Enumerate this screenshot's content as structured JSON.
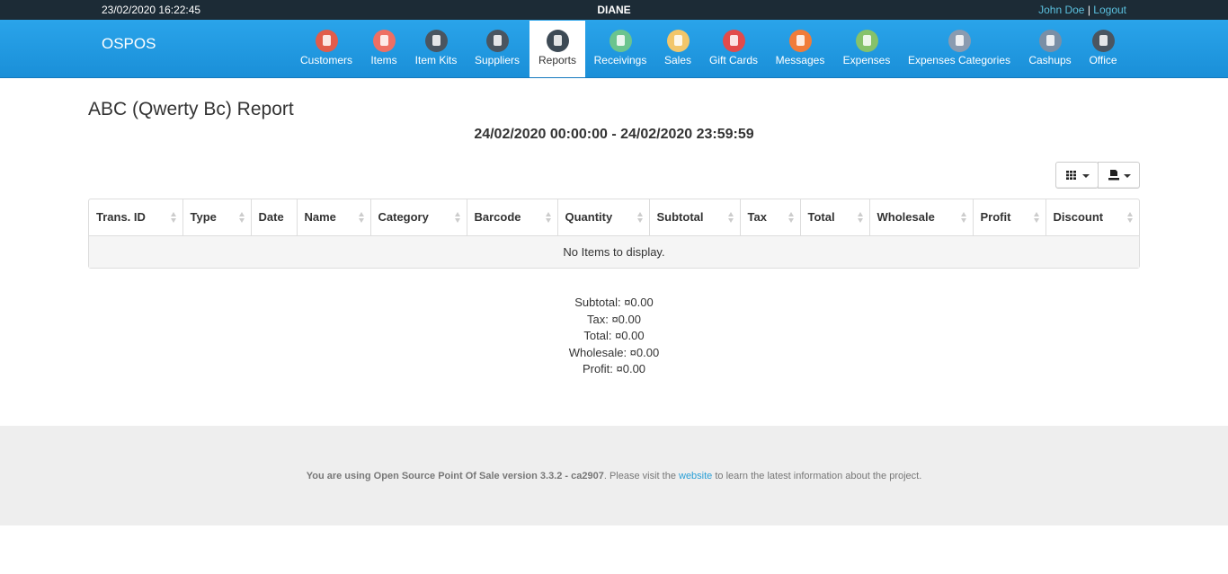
{
  "topbar": {
    "datetime": "23/02/2020 16:22:45",
    "store": "DIANE",
    "user_name": "John Doe",
    "separator": "|",
    "logout": "Logout"
  },
  "nav": {
    "brand": "OSPOS",
    "items": [
      {
        "label": "Customers",
        "icon": "customers-icon",
        "color": "#e15c4b"
      },
      {
        "label": "Items",
        "icon": "items-icon",
        "color": "#ee6f64"
      },
      {
        "label": "Item Kits",
        "icon": "item-kits-icon",
        "color": "#4a5560"
      },
      {
        "label": "Suppliers",
        "icon": "suppliers-icon",
        "color": "#4a5560"
      },
      {
        "label": "Reports",
        "icon": "reports-icon",
        "color": "#3d4a55"
      },
      {
        "label": "Receivings",
        "icon": "receivings-icon",
        "color": "#6bc48e"
      },
      {
        "label": "Sales",
        "icon": "sales-icon",
        "color": "#f2c66a"
      },
      {
        "label": "Gift Cards",
        "icon": "gift-cards-icon",
        "color": "#e24b4b"
      },
      {
        "label": "Messages",
        "icon": "messages-icon",
        "color": "#f07c3a"
      },
      {
        "label": "Expenses",
        "icon": "expenses-icon",
        "color": "#86c26a"
      },
      {
        "label": "Expenses Categories",
        "icon": "expenses-categories-icon",
        "color": "#8a9bb0"
      },
      {
        "label": "Cashups",
        "icon": "cashups-icon",
        "color": "#7a8fa6"
      },
      {
        "label": "Office",
        "icon": "office-icon",
        "color": "#4a5560"
      }
    ]
  },
  "report": {
    "title": "ABC (Qwerty Bc) Report",
    "date_range": "24/02/2020 00:00:00 - 24/02/2020 23:59:59",
    "columns": [
      "Trans. ID",
      "Type",
      "Date",
      "Name",
      "Category",
      "Barcode",
      "Quantity",
      "Subtotal",
      "Tax",
      "Total",
      "Wholesale",
      "Profit",
      "Discount"
    ],
    "empty_message": "No Items to display."
  },
  "summary": {
    "subtotal": "Subtotal: ¤0.00",
    "tax": "Tax: ¤0.00",
    "total": "Total: ¤0.00",
    "wholesale": "Wholesale: ¤0.00",
    "profit": "Profit: ¤0.00"
  },
  "footer": {
    "strong": "You are using Open Source Point Of Sale version 3.3.2 - ca2907",
    "text_before": ". Please visit the ",
    "link": "website",
    "text_after": " to learn the latest information about the project."
  }
}
